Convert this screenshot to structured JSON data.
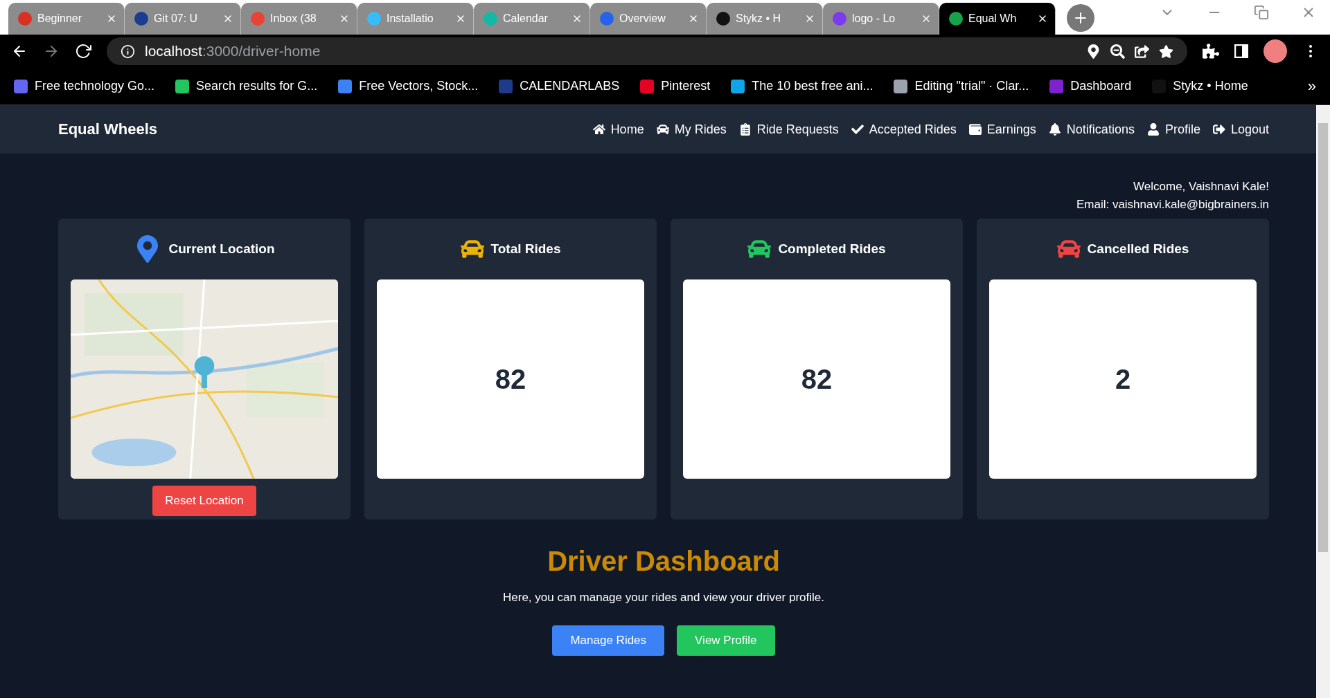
{
  "browser": {
    "tabs": [
      {
        "title": "Beginner",
        "selected": false,
        "color": "#d93025"
      },
      {
        "title": "Git 07: U",
        "selected": false,
        "color": "#1a3d8f"
      },
      {
        "title": "Inbox (38",
        "selected": false,
        "color": "#ea4335"
      },
      {
        "title": "Installatio",
        "selected": false,
        "color": "#38bdf8"
      },
      {
        "title": "Calendar",
        "selected": false,
        "color": "#14b8a6"
      },
      {
        "title": "Overview",
        "selected": false,
        "color": "#2563eb"
      },
      {
        "title": "Stykz • H",
        "selected": false,
        "color": "#111111"
      },
      {
        "title": "logo - Lo",
        "selected": false,
        "color": "#7c3aed"
      },
      {
        "title": "Equal Wh",
        "selected": true,
        "color": "#16a34a"
      }
    ],
    "address": {
      "host": "localhost",
      "path": ":3000/driver-home"
    },
    "bookmarks": [
      {
        "title": "Free technology Go...",
        "color": "#6366f1"
      },
      {
        "title": "Search results for G...",
        "color": "#22c55e"
      },
      {
        "title": "Free Vectors, Stock...",
        "color": "#3b82f6"
      },
      {
        "title": "CALENDARLABS",
        "color": "#1e3a8a"
      },
      {
        "title": "Pinterest",
        "color": "#e60023"
      },
      {
        "title": "The 10 best free ani...",
        "color": "#0ea5e9"
      },
      {
        "title": "Editing \"trial\" · Clar...",
        "color": "#9ca3af"
      },
      {
        "title": "Dashboard",
        "color": "#7e22ce"
      },
      {
        "title": "Stykz • Home",
        "color": "#111111"
      }
    ],
    "overflow": "»"
  },
  "app": {
    "brand": "Equal Wheels",
    "nav": [
      {
        "kind": "home",
        "label": "Home"
      },
      {
        "kind": "car",
        "label": "My Rides"
      },
      {
        "kind": "clipboard",
        "label": "Ride Requests"
      },
      {
        "kind": "check",
        "label": "Accepted Rides"
      },
      {
        "kind": "wallet",
        "label": "Earnings"
      },
      {
        "kind": "bell",
        "label": "Notifications"
      },
      {
        "kind": "user",
        "label": "Profile"
      },
      {
        "kind": "logout",
        "label": "Logout"
      }
    ],
    "welcome": "Welcome, Vaishnavi Kale!",
    "email": "Email: vaishnavi.kale@bigbrainers.in",
    "cards": [
      {
        "kind": "location",
        "title": "Current Location",
        "color": "#3b82f6",
        "button": "Reset Location"
      },
      {
        "kind": "stat",
        "title": "Total Rides",
        "color": "#eab308",
        "value": "82"
      },
      {
        "kind": "stat",
        "title": "Completed Rides",
        "color": "#22c55e",
        "value": "82"
      },
      {
        "kind": "stat",
        "title": "Cancelled Rides",
        "color": "#ef4444",
        "value": "2"
      }
    ],
    "heading": "Driver Dashboard",
    "text": "Here, you can manage your rides and view your driver profile.",
    "buttons": [
      {
        "kind": "primary",
        "label": "Manage Rides"
      },
      {
        "kind": "success",
        "label": "View Profile"
      }
    ]
  }
}
